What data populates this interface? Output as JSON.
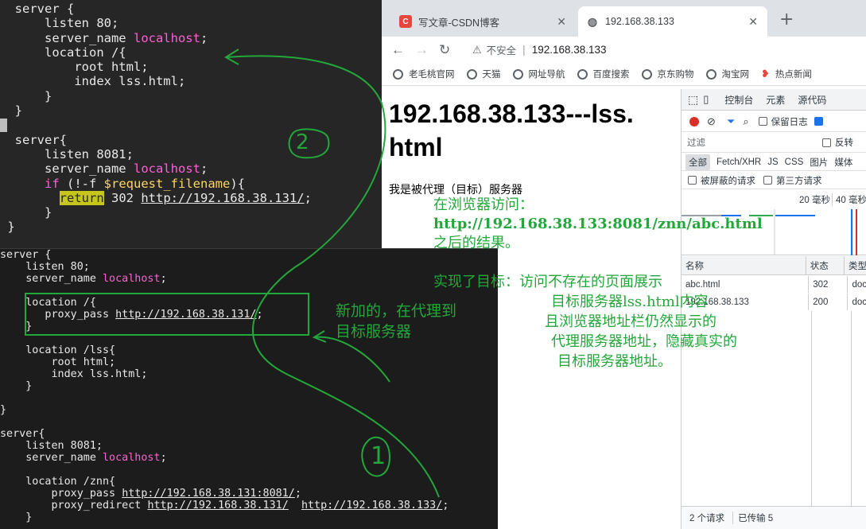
{
  "terminal_top": {
    "lines": [
      "  server {",
      "      listen 80;",
      "      server_name localhost;",
      "      location /{",
      "          root html;",
      "          index lss.html;",
      "      }",
      "  }",
      "",
      "  server{",
      "      listen 8081;",
      "      server_name localhost;",
      "      if (!-f $request_filename){",
      "        return 302 http://192.168.38.131/;",
      "      }",
      " }"
    ]
  },
  "terminal_bottom": {
    "lines": [
      "server {",
      "    listen 80;",
      "    server_name localhost;",
      "",
      "    location /{",
      "       proxy_pass http://192.168.38.131/;",
      "    }",
      "",
      "    location /lss{",
      "        root html;",
      "        index lss.html;",
      "    }",
      "",
      "}",
      "",
      "server{",
      "    listen 8081;",
      "    server_name localhost;",
      "",
      "    location /znn{",
      "        proxy_pass http://192.168.38.131:8081/;",
      "        proxy_redirect http://192.168.38.131/  http://192.168.38.133/;",
      "    }"
    ]
  },
  "browser": {
    "tabs": [
      {
        "title": "写文章-CSDN博客",
        "icon": "csdn-icon",
        "active": false
      },
      {
        "title": "192.168.38.133",
        "icon": "globe-icon",
        "active": true
      }
    ],
    "security_label": "不安全",
    "url": "192.168.38.133",
    "bookmarks": [
      "老毛桃官网",
      "天猫",
      "网址导航",
      "百度搜索",
      "京东购物",
      "淘宝网",
      "热点新闻"
    ],
    "page": {
      "heading": "192.168.38.133---lss.html",
      "body": "我是被代理（目标）服务器"
    }
  },
  "devtools": {
    "tabs": [
      "控制台",
      "元素",
      "源代码"
    ],
    "preserve_log": "保留日志",
    "filter_placeholder": "过滤",
    "invert": "反转",
    "types": [
      "全部",
      "Fetch/XHR",
      "JS",
      "CSS",
      "图片",
      "媒体"
    ],
    "hide_blocked": "被屏蔽的请求",
    "third_party": "第三方请求",
    "ruler": [
      "20 毫秒",
      "40 毫秒"
    ],
    "columns": [
      "名称",
      "状态",
      "类型"
    ],
    "requests": [
      {
        "name": "abc.html",
        "status": "302",
        "type": "doc"
      },
      {
        "name": "192.168.38.133",
        "status": "200",
        "type": "doc"
      }
    ],
    "footer": [
      "2 个请求",
      "已传输 5"
    ]
  },
  "annotations": {
    "circle_two": "2",
    "circle_one": "1",
    "result_title": "在浏览器访问：",
    "result_url": "http://192.168.38.133:8081/znn/abc.html",
    "result_tail": "之后的结果。",
    "goal_lines": [
      "实现了目标：访问不存在的页面展示",
      "目标服务器lss.html内容",
      "且浏览器地址栏仍然显示的",
      "代理服务器地址，隐藏真实的",
      "目标服务器地址。"
    ],
    "new_added_lines": [
      "新加的，在代理到",
      "目标服务器"
    ]
  },
  "colors": {
    "annotation": "#22a83a",
    "keyword": "#ff5fd7",
    "variable": "#ffd75f",
    "highlight": "#c5c51b"
  }
}
